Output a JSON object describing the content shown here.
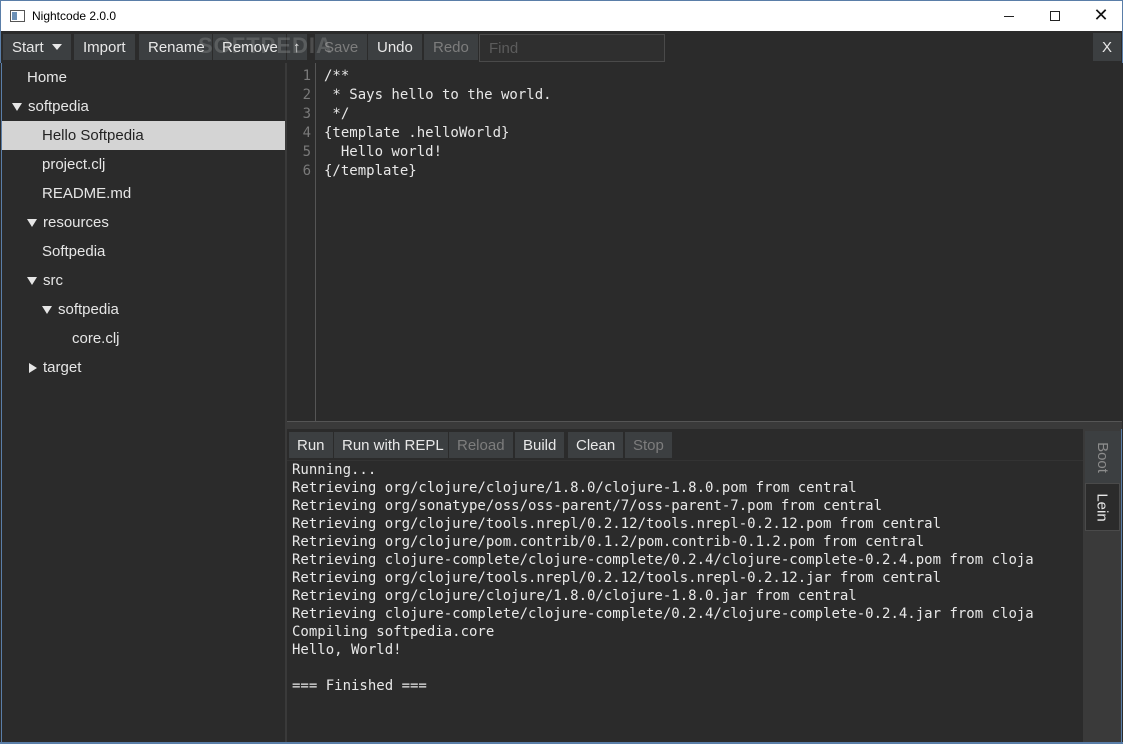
{
  "window": {
    "title": "Nightcode 2.0.0"
  },
  "toolbar": {
    "start": "Start",
    "import": "Import",
    "rename": "Rename",
    "remove": "Remove",
    "up": "↑",
    "save": "Save",
    "undo": "Undo",
    "redo": "Redo",
    "find_placeholder": "Find",
    "close": "X"
  },
  "watermark": "SOFTPEDIA",
  "tree": {
    "home": "Home",
    "softpedia": "softpedia",
    "hello_softpedia": "Hello Softpedia",
    "project_clj": "project.clj",
    "readme": "README.md",
    "resources": "resources",
    "resources_softpedia": "Softpedia",
    "src": "src",
    "src_softpedia": "softpedia",
    "core_clj": "core.clj",
    "target": "target"
  },
  "editor": {
    "line_numbers": [
      "1",
      "2",
      "3",
      "4",
      "5",
      "6"
    ],
    "lines": [
      "/**",
      " * Says hello to the world.",
      " */",
      "{template .helloWorld}",
      "  Hello world!",
      "{/template}"
    ]
  },
  "build": {
    "run": "Run",
    "run_with_repl": "Run with REPL",
    "reload": "Reload",
    "build": "Build",
    "clean": "Clean",
    "stop": "Stop",
    "tab_boot": "Boot",
    "tab_lein": "Lein",
    "console": [
      "Running...",
      "Retrieving org/clojure/clojure/1.8.0/clojure-1.8.0.pom from central",
      "Retrieving org/sonatype/oss/oss-parent/7/oss-parent-7.pom from central",
      "Retrieving org/clojure/tools.nrepl/0.2.12/tools.nrepl-0.2.12.pom from central",
      "Retrieving org/clojure/pom.contrib/0.1.2/pom.contrib-0.1.2.pom from central",
      "Retrieving clojure-complete/clojure-complete/0.2.4/clojure-complete-0.2.4.pom from cloja",
      "Retrieving org/clojure/tools.nrepl/0.2.12/tools.nrepl-0.2.12.jar from central",
      "Retrieving org/clojure/clojure/1.8.0/clojure-1.8.0.jar from central",
      "Retrieving clojure-complete/clojure-complete/0.2.4/clojure-complete-0.2.4.jar from cloja",
      "Compiling softpedia.core",
      "Hello, World!",
      "",
      "=== Finished ==="
    ]
  },
  "colors": {
    "background": "#2b2b2b",
    "button": "#3c3f41",
    "selected": "#d4d4d4",
    "text": "#e8e8e8",
    "disabled_text": "#7d7d7d",
    "window_border": "#5a7ea8"
  }
}
